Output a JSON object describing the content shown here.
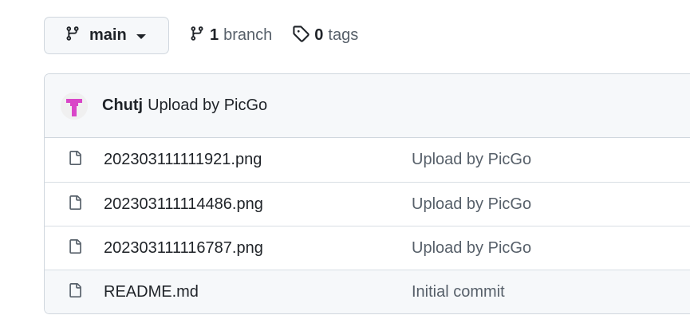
{
  "branch_selector": {
    "current_branch": "main",
    "icon": "git-branch-icon"
  },
  "branches": {
    "count": "1",
    "label": "branch",
    "icon": "git-branch-icon"
  },
  "tags": {
    "count": "0",
    "label": "tags",
    "icon": "tag-icon"
  },
  "latest_commit": {
    "author": "Chutj",
    "message": "Upload by PicGo",
    "avatar_color": "#d946c8"
  },
  "files": [
    {
      "name": "202303111111921.png",
      "commit_message": "Upload by PicGo",
      "icon": "file-icon"
    },
    {
      "name": "202303111114486.png",
      "commit_message": "Upload by PicGo",
      "icon": "file-icon"
    },
    {
      "name": "202303111116787.png",
      "commit_message": "Upload by PicGo",
      "icon": "file-icon"
    },
    {
      "name": "README.md",
      "commit_message": "Initial commit",
      "icon": "file-icon"
    }
  ],
  "colors": {
    "border": "#d0d7de",
    "header_bg": "#f6f8fa",
    "text": "#1f2328",
    "muted": "#57606a"
  }
}
